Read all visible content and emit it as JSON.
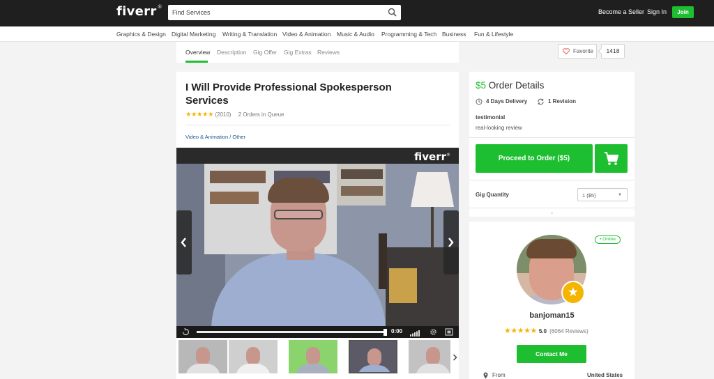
{
  "header": {
    "logo": "fiverr",
    "search_placeholder": "Find Services",
    "become_seller": "Become a Seller",
    "sign_in": "Sign In",
    "join": "Join"
  },
  "categories": [
    "Graphics & Design",
    "Digital Marketing",
    "Writing & Translation",
    "Video & Animation",
    "Music & Audio",
    "Programming & Tech",
    "Business",
    "Fun & Lifestyle"
  ],
  "tabs": [
    "Overview",
    "Description",
    "Gig Offer",
    "Gig Extras",
    "Reviews"
  ],
  "favorite": {
    "label": "Favorite",
    "count": "1418"
  },
  "gig": {
    "title": "I Will Provide Professional Spokesperson Services",
    "rating_stars": 5,
    "review_count": "(2010)",
    "queue": "2 Orders in Queue",
    "breadcrumb": "Video & Animation / Other",
    "video_logo": "fiverr",
    "video_time": "0:00",
    "video_progress": 1.0
  },
  "order": {
    "price": "$5",
    "title": "Order Details",
    "delivery": "4 Days Delivery",
    "revision": "1 Revision",
    "package_name": "testimonial",
    "package_desc": "real-looking review",
    "proceed": "Proceed to Order ($5)",
    "qty_label": "Gig Quantity",
    "qty_value": "1 ($5)"
  },
  "seller": {
    "status": "• Online",
    "username": "banjoman15",
    "rating_stars": 5,
    "score": "5.0",
    "reviews": "(6064 Reviews)",
    "contact": "Contact Me",
    "from_label": "From",
    "from_value": "United States"
  },
  "colors": {
    "brand": "#1dbf31",
    "header": "#1f1f1f",
    "star": "#f5b400"
  }
}
